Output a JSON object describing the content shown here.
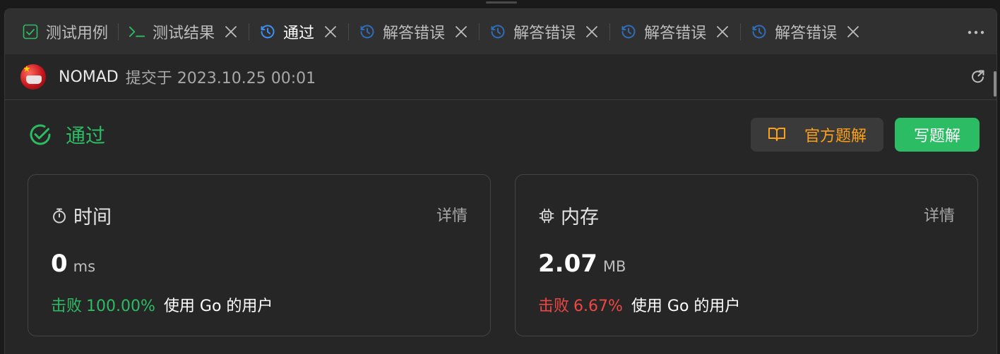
{
  "tabs": [
    {
      "label": "测试用例",
      "icon": "checkbox-icon",
      "closable": false,
      "active": false
    },
    {
      "label": "测试结果",
      "icon": "terminal-icon",
      "closable": true,
      "active": false
    },
    {
      "label": "通过",
      "icon": "history-icon",
      "closable": true,
      "active": true
    },
    {
      "label": "解答错误",
      "icon": "history-icon",
      "closable": true,
      "active": false
    },
    {
      "label": "解答错误",
      "icon": "history-icon",
      "closable": true,
      "active": false
    },
    {
      "label": "解答错误",
      "icon": "history-icon",
      "closable": true,
      "active": false
    },
    {
      "label": "解答错误",
      "icon": "history-icon",
      "closable": true,
      "active": false
    }
  ],
  "submission": {
    "user": "NOMAD",
    "meta": "提交于 2023.10.25 00:01"
  },
  "status": {
    "label": "通过",
    "color": "#2cbc63"
  },
  "actions": {
    "official_solution": "官方题解",
    "write_solution": "写题解"
  },
  "time_card": {
    "title": "时间",
    "detail": "详情",
    "value": "0",
    "unit": "ms",
    "beat_label": "击败",
    "beat_pct": "100.00%",
    "beat_rest": "使用 Go 的用户"
  },
  "memory_card": {
    "title": "内存",
    "detail": "详情",
    "value": "2.07",
    "unit": "MB",
    "beat_label": "击败",
    "beat_pct": "6.67%",
    "beat_rest": "使用 Go 的用户"
  },
  "colors": {
    "accent_green": "#2cbc63",
    "accent_orange": "#ffa116",
    "error_red": "#ef4743",
    "tab_blue": "#3d8ef0"
  }
}
